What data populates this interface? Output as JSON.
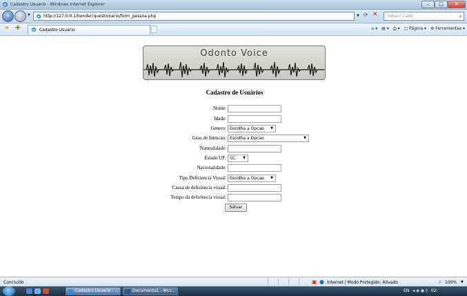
{
  "window": {
    "title": "Cadastro Usuario - Windows Internet Explorer",
    "controls": {
      "minimize": "–",
      "maximize": "□",
      "close": "✕"
    }
  },
  "address_bar": {
    "url": "http://127.0.0.1/bender/questionario/form_pessoa.php",
    "search_placeholder": "Yahoo! Cadê"
  },
  "command_bar": {
    "tab_label": "Cadastro Usuario",
    "page_menu": "Página",
    "tools_menu": "Ferramentas"
  },
  "page": {
    "banner_title": "Odonto Voice",
    "form_title": "Cadastro de Usuários",
    "fields": [
      {
        "label": "Nome:",
        "type": "text",
        "value": ""
      },
      {
        "label": "Idade:",
        "type": "text",
        "value": ""
      },
      {
        "label": "Genero:",
        "type": "select",
        "value": "Escolha a Opcao"
      },
      {
        "label": "Grau de Intrucao:",
        "type": "select",
        "value": "Escolha a Opcao"
      },
      {
        "label": "Naturalidade:",
        "type": "text",
        "value": ""
      },
      {
        "label": "Estado UF:",
        "type": "select",
        "value": "SC"
      },
      {
        "label": "Nacionalidade:",
        "type": "text",
        "value": ""
      },
      {
        "label": "Tipo Deficiencia Visual:",
        "type": "select",
        "value": "Escolha a Opcao"
      },
      {
        "label": "Causa de deficiencia visual:",
        "type": "text",
        "value": ""
      },
      {
        "label": "Tempo da deficiencia visual:",
        "type": "text",
        "value": ""
      }
    ],
    "submit_label": "Salvar"
  },
  "status_bar": {
    "status": "Concluído",
    "zone": "Internet | Modo Protegido: Ativado",
    "zoom": "100%"
  },
  "taskbar": {
    "tasks": [
      "Cadastro Usuario - ...",
      "Documento1 - Micr..."
    ],
    "tray": {
      "lang": "EN",
      "clock": "02:"
    }
  }
}
